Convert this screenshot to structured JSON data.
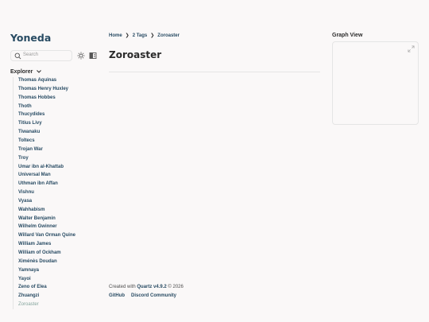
{
  "site": {
    "title": "Yoneda"
  },
  "search": {
    "placeholder": "Search"
  },
  "explorer": {
    "title": "Explorer",
    "items": [
      "Thomas Aquinas",
      "Thomas Henry Huxley",
      "Thomas Hobbes",
      "Thoth",
      "Thucydides",
      "Titius Livy",
      "Tiwanaku",
      "Toltecs",
      "Trojan War",
      "Troy",
      "Umar ibn al-Khattab",
      "Universal Man",
      "Uthman ibn Affan",
      "Vishnu",
      "Vyasa",
      "Wahhabism",
      "Walter Benjamin",
      "Wilhelm Gwinner",
      "Willard Van Orman Quine",
      "William James",
      "William of Ockham",
      "Ximénès Doudan",
      "Yamnaya",
      "Yayoi",
      "Zeno of Elea",
      "Zhuangzi",
      "Zoroaster"
    ],
    "active": "Zoroaster"
  },
  "breadcrumb": {
    "home": "Home",
    "tags": "2 Tags",
    "current": "Zoroaster",
    "separator": "❯"
  },
  "page": {
    "title": "Zoroaster"
  },
  "footer": {
    "created_prefix": "Created with",
    "quartz_link": "Quartz v4.9.2",
    "copyright": "© 2026",
    "links": [
      "GitHub",
      "Discord Community"
    ]
  },
  "graph": {
    "title": "Graph View"
  },
  "colors": {
    "accent": "#284b63",
    "active": "#84a59d",
    "border": "#e5e5e5",
    "background": "#faf8f8"
  },
  "icons": {
    "search": "search-icon",
    "theme": "sun-icon",
    "reader": "book-icon",
    "chevron": "chevron-down-icon",
    "graph": "expand-icon"
  }
}
